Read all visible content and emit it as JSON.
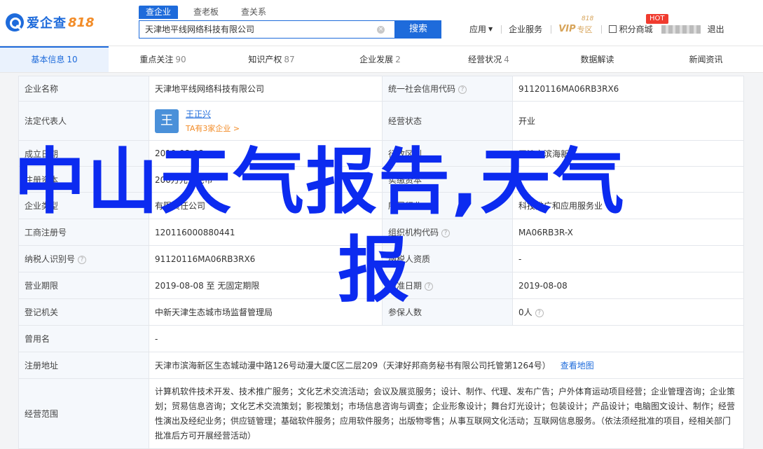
{
  "header": {
    "logo_text": "爱企查",
    "logo_num": "818",
    "search_tabs": [
      "查企业",
      "查老板",
      "查关系"
    ],
    "search_value": "天津地平线网络科技有限公司",
    "search_button": "搜索",
    "nav": {
      "app": "应用",
      "enterprise_service": "企业服务",
      "vip": "VIP",
      "vip_zone": "专区",
      "vip_badge": "818",
      "points_mall": "积分商城",
      "hot": "HOT",
      "logout": "退出"
    }
  },
  "tabs": [
    {
      "label": "基本信息",
      "count": "10"
    },
    {
      "label": "重点关注",
      "count": "90"
    },
    {
      "label": "知识产权",
      "count": "87"
    },
    {
      "label": "企业发展",
      "count": "2"
    },
    {
      "label": "经营状况",
      "count": "4"
    },
    {
      "label": "数据解读",
      "count": ""
    },
    {
      "label": "新闻资讯",
      "count": ""
    }
  ],
  "info": {
    "company_name_label": "企业名称",
    "company_name": "天津地平线网络科技有限公司",
    "credit_code_label": "统一社会信用代码",
    "credit_code": "91120116MA06RB3RX6",
    "legal_rep_label": "法定代表人",
    "legal_rep_avatar": "王",
    "legal_rep_name": "王正兴",
    "legal_rep_sub": "TA有3家企业 >",
    "status_label": "经营状态",
    "status": "开业",
    "founded_label": "成立日期",
    "founded": "2019-08-08",
    "region_label": "行政区划",
    "region": "天津市滨海新区",
    "capital_label": "注册资本",
    "capital": "200万元人民币",
    "paid_label": "实缴资本",
    "paid": "-",
    "type_label": "企业类型",
    "type": "有限责任公司",
    "industry_label": "所属行业",
    "industry": "科技推广和应用服务业",
    "reg_no_label": "工商注册号",
    "reg_no": "120116000880441",
    "org_code_label": "组织机构代码",
    "org_code": "MA06RB3R-X",
    "taxpayer_label": "纳税人识别号",
    "taxpayer": "91120116MA06RB3RX6",
    "taxpayer_q_label": "纳税人资质",
    "taxpayer_q": "-",
    "term_label": "营业期限",
    "term": "2019-08-08 至 无固定期限",
    "approved_label": "核准日期",
    "approved": "2019-08-08",
    "authority_label": "登记机关",
    "authority": "中新天津生态城市场监督管理局",
    "insured_label": "参保人数",
    "insured": "0人",
    "former_label": "曾用名",
    "former": "-",
    "address_label": "注册地址",
    "address": "天津市滨海新区生态城动漫中路126号动漫大厦C区二层209（天津好邦商务秘书有限公司托管第1264号）",
    "map_link": "查看地图",
    "scope_label": "经营范围",
    "scope": "计算机软件技术开发、技术推广服务；文化艺术交流活动；会议及展览服务；设计、制作、代理、发布广告；户外体育运动项目经营；企业管理咨询；企业策划；贸易信息咨询；文化艺术交流策划；影视策划；市场信息咨询与调查；企业形象设计；舞台灯光设计；包装设计；产品设计；电脑图文设计、制作；经营性演出及经纪业务；供应链管理；基础软件服务；应用软件服务；出版物零售；从事互联网文化活动；互联网信息服务。（依法须经批准的项目，经相关部门批准后方可开展经营活动）"
  },
  "overlay": {
    "line1": "中山天气报告,天气",
    "line2": "报"
  }
}
